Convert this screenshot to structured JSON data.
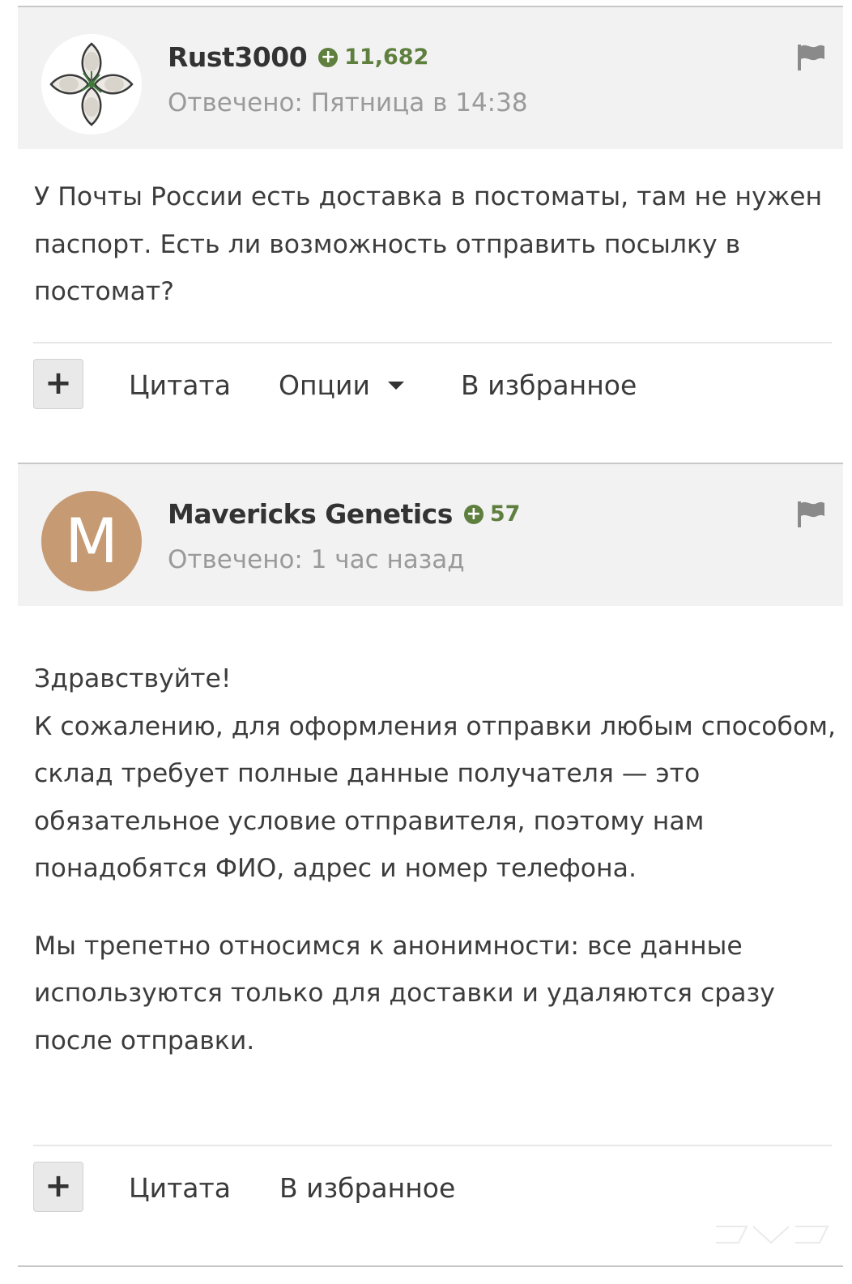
{
  "posts": [
    {
      "username": "Rust3000",
      "reputation": "11,682",
      "answered": "Отвечено: Пятница в 14:38",
      "avatar": "flower-avatar",
      "body": [
        "У Почты России есть доставка в постоматы, там не нужен паспорт. Есть ли возможность отправить посылку в постомат?"
      ],
      "actions": {
        "plus": "+",
        "quote": "Цитата",
        "options": "Опции",
        "favorite": "В избранное"
      }
    },
    {
      "username": "Mavericks Genetics",
      "reputation": "57",
      "answered": "Отвечено: 1 час назад",
      "avatar_letter": "M",
      "body": [
        "Здравствуйте!\nК сожалению, для оформления отправки любым способом, склад требует полные данные получателя — это обязательное условие отправителя, поэтому нам понадобятся ФИО, адрес и номер телефона.",
        "Мы трепетно относимся к анонимности: все данные используются только для доставки и удаляются сразу после отправки."
      ],
      "actions": {
        "plus": "+",
        "quote": "Цитата",
        "favorite": "В избранное"
      }
    }
  ],
  "icons": {
    "reputation": "plus-circle-icon",
    "report": "flag-icon",
    "options": "caret-down-icon"
  },
  "colors": {
    "header_bg": "#f2f2f2",
    "reputation": "#5f7f3f",
    "muted_text": "#9a9a9a",
    "avatar_letter_bg": "#c69a72"
  }
}
